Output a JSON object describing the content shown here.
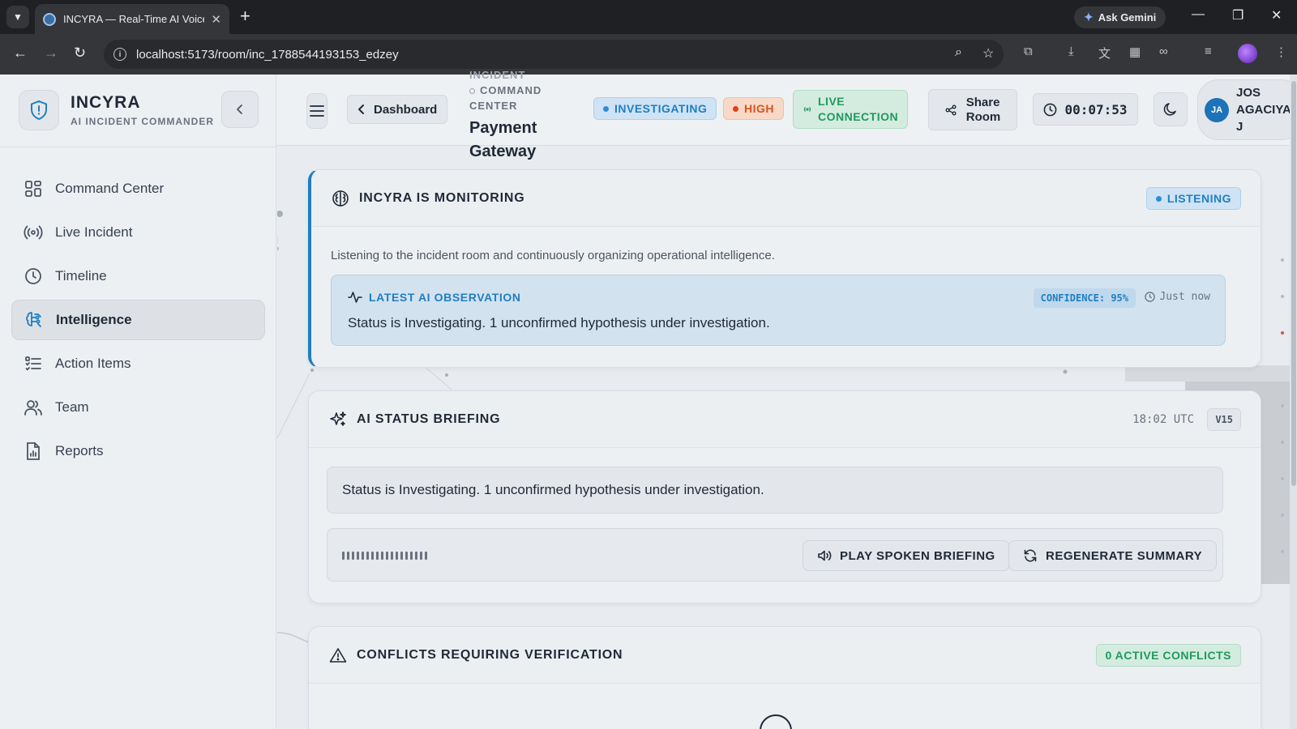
{
  "browser": {
    "tab_title": "INCYRA — Real-Time AI Voice I",
    "new_tab_glyph": "+",
    "ask_gemini": "Ask Gemini",
    "url": "localhost:5173/room/inc_1788544193153_edzey"
  },
  "sidebar": {
    "brand_name": "INCYRA",
    "brand_sub": "AI INCIDENT COMMANDER",
    "items": [
      {
        "label": "Command Center",
        "icon": "grid-icon"
      },
      {
        "label": "Live Incident",
        "icon": "broadcast-icon"
      },
      {
        "label": "Timeline",
        "icon": "clock-icon"
      },
      {
        "label": "Intelligence",
        "icon": "brain-icon",
        "active": true
      },
      {
        "label": "Action Items",
        "icon": "list-icon"
      },
      {
        "label": "Team",
        "icon": "users-icon"
      },
      {
        "label": "Reports",
        "icon": "report-icon"
      }
    ]
  },
  "header": {
    "dashboard_label": "Dashboard",
    "cc_cut_label": "INCIDENT",
    "cc_label_1": "COMMAND",
    "cc_label_2": "CENTER",
    "incident_line_1": "Payment",
    "incident_line_2": "Gateway",
    "status_badge": "INVESTIGATING",
    "severity_badge": "HIGH",
    "live_line_1": "LIVE",
    "live_line_2": "CONNECTION",
    "share_line_1": "Share",
    "share_line_2": "Room",
    "timer": "00:07:53",
    "user_initials": "JA",
    "user_line_1": "JOS",
    "user_line_2": "AGACIYA",
    "user_line_3": "J"
  },
  "monitoring": {
    "title": "INCYRA IS MONITORING",
    "status": "LISTENING",
    "description": "Listening to the incident room and continuously organizing operational intelligence.",
    "observation_label": "LATEST AI OBSERVATION",
    "confidence": "CONFIDENCE: 95%",
    "time": "Just now",
    "observation_text": "Status is Investigating. 1 unconfirmed hypothesis under investigation."
  },
  "briefing": {
    "title": "AI STATUS BRIEFING",
    "time": "18:02 UTC",
    "version": "V15",
    "summary": "Status is Investigating. 1 unconfirmed hypothesis under investigation.",
    "play_label": "PLAY SPOKEN BRIEFING",
    "regen_label": "REGENERATE SUMMARY"
  },
  "conflicts": {
    "title": "CONFLICTS REQUIRING VERIFICATION",
    "count_badge": "0 ACTIVE CONFLICTS"
  },
  "colors": {
    "accent_blue": "#1f7fc2",
    "severity_orange": "#d9541e",
    "live_green": "#1e9a5d"
  }
}
